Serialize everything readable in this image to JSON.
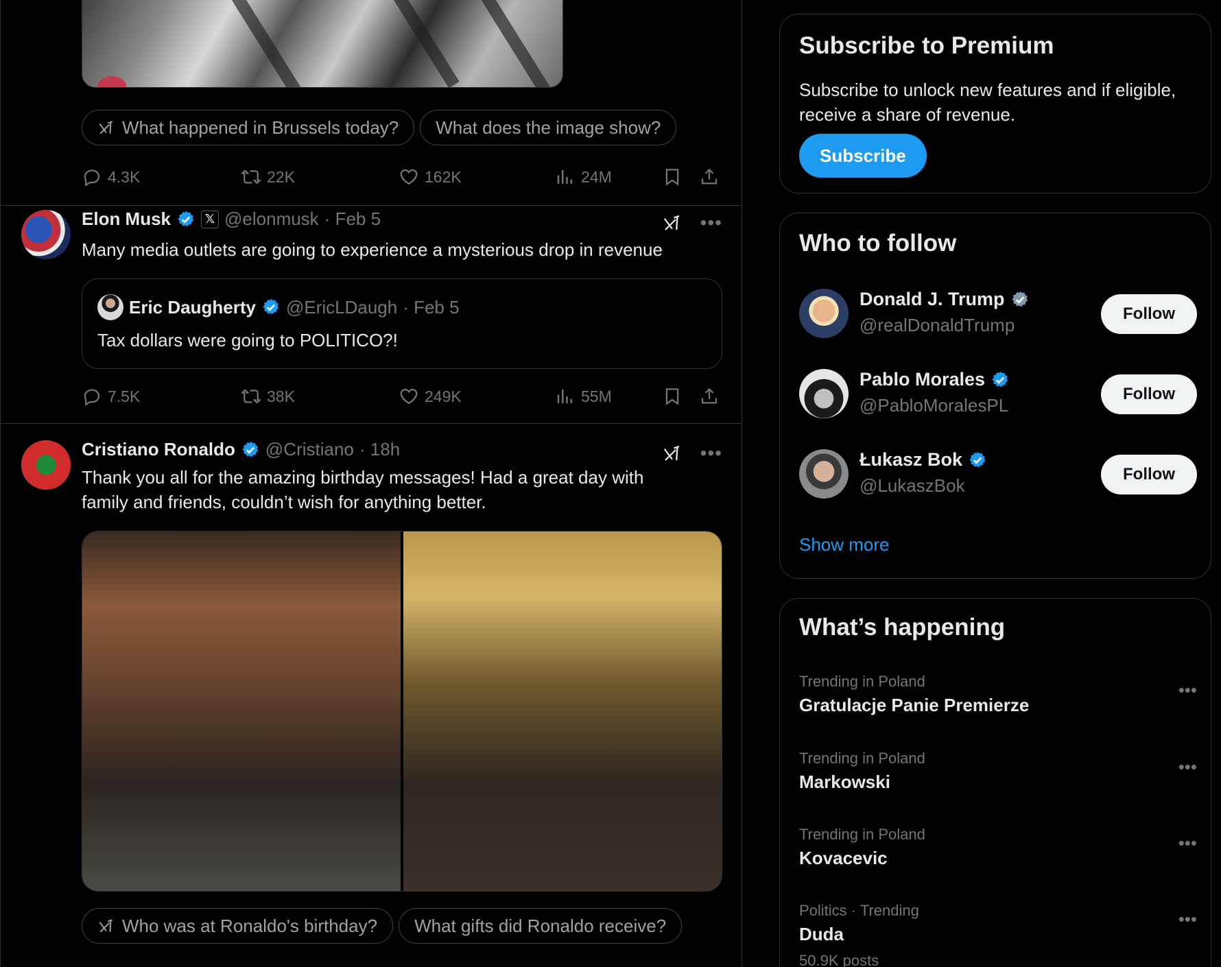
{
  "tweet1": {
    "chips": [
      "What happened in Brussels today?",
      "What does the image show?"
    ],
    "replies": "4.3K",
    "reposts": "22K",
    "likes": "162K",
    "views": "24M"
  },
  "tweet2": {
    "name": "Elon Musk",
    "affiliate_badge": "𝕏",
    "handle": "@elonmusk",
    "time": "· Feb 5",
    "text": "Many media outlets are going to experience a mysterious drop in revenue",
    "quote": {
      "name": "Eric Daugherty",
      "handle": "@EricLDaugh",
      "time": "· Feb 5",
      "text": "Tax dollars were going to POLITICO?!"
    },
    "replies": "7.5K",
    "reposts": "38K",
    "likes": "249K",
    "views": "55M"
  },
  "tweet3": {
    "name": "Cristiano Ronaldo",
    "handle": "@Cristiano",
    "time": "· 18h",
    "text_line1": "Thank you all for the amazing birthday messages! Had a great day with",
    "text_line2": "family and friends, couldn’t wish for anything better.",
    "chips": [
      "Who was at Ronaldo's birthday?",
      "What gifts did Ronaldo receive?"
    ]
  },
  "premium": {
    "title": "Subscribe to Premium",
    "description": "Subscribe to unlock new features and if eligible, receive a share of revenue.",
    "button": "Subscribe"
  },
  "who_to_follow": {
    "title": "Who to follow",
    "accounts": [
      {
        "name": "Donald J. Trump",
        "handle": "@realDonaldTrump",
        "badge": "gray",
        "button": "Follow"
      },
      {
        "name": "Pablo Morales",
        "handle": "@PabloMoralesPL",
        "badge": "blue",
        "button": "Follow"
      },
      {
        "name": "Łukasz Bok",
        "handle": "@LukaszBok",
        "badge": "blue",
        "button": "Follow"
      }
    ],
    "show_more": "Show more"
  },
  "whats_happening": {
    "title": "What’s happening",
    "trends": [
      {
        "context": "Trending in Poland",
        "topic": "Gratulacje Panie Premierze",
        "count": ""
      },
      {
        "context": "Trending in Poland",
        "topic": "Markowski",
        "count": ""
      },
      {
        "context": "Trending in Poland",
        "topic": "Kovacevic",
        "count": ""
      },
      {
        "context": "Politics · Trending",
        "topic": "Duda",
        "count": "50.9K posts"
      }
    ]
  },
  "colors": {
    "accent": "#1d9bf0",
    "verified_gray": "#829aab",
    "text_secondary": "#71767b"
  }
}
